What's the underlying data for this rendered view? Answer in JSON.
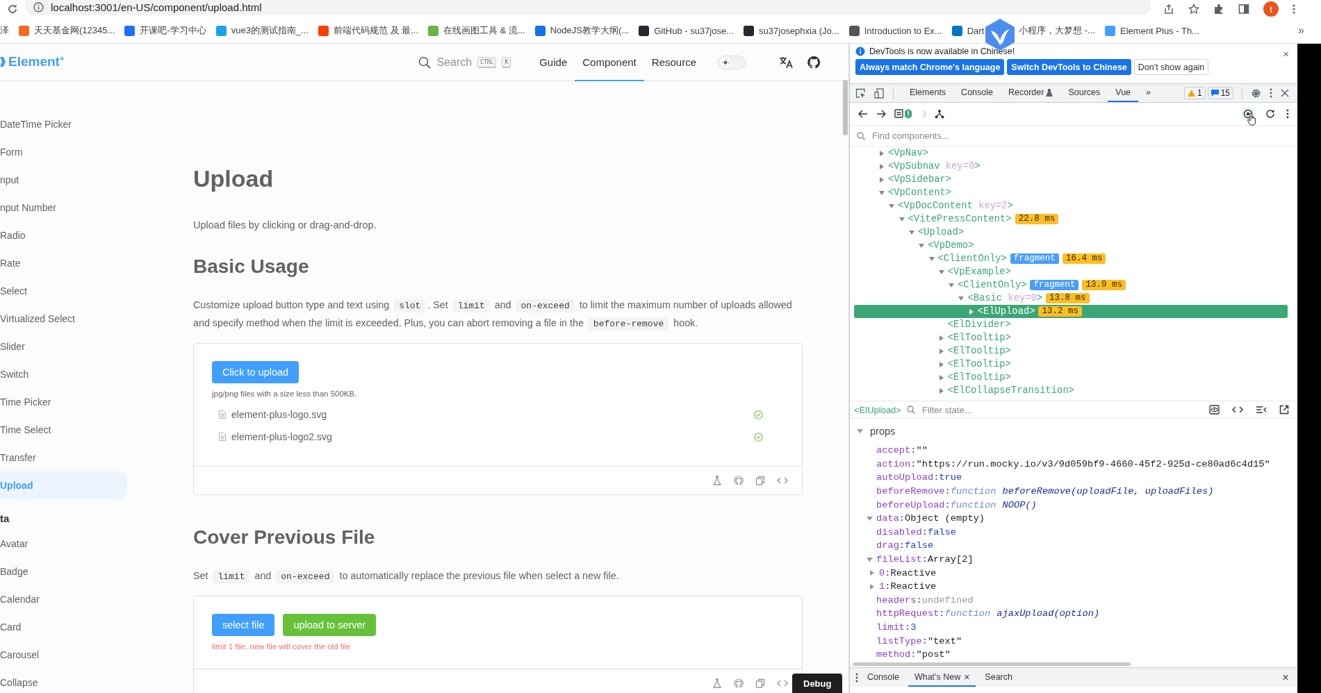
{
  "browser": {
    "url": "localhost:3001/en-US/component/upload.html",
    "avatar": "t",
    "more": "»",
    "bookmarks": [
      {
        "label": "泽"
      },
      {
        "label": "天天基金网(12345...",
        "color": "#f36c21"
      },
      {
        "label": "开课吧-学习中心",
        "color": "#1e6fff"
      },
      {
        "label": "vue3的测试指南_...",
        "color": "#1aa3e8"
      },
      {
        "label": "前端代码规范 及 最...",
        "color": "#ff3d00"
      },
      {
        "label": "在线画图工具 & 流...",
        "color": "#6bb543"
      },
      {
        "label": "NodeJS教学大纲(...",
        "color": "#1473e6"
      },
      {
        "label": "GitHub - su37jose...",
        "color": "#24292f"
      },
      {
        "label": "su37josephxia (Jo...",
        "color": "#24292f"
      },
      {
        "label": "Introduction to Ex...",
        "color": "#555555"
      },
      {
        "label": "Dart",
        "color": "#0175c2"
      },
      {
        "label": "小程序，大梦想 -..."
      },
      {
        "label": "Element Plus - Th...",
        "color": "#409eff"
      }
    ]
  },
  "header": {
    "logo": "Element$^{+}$",
    "search": "Search",
    "keys": [
      "CTRL",
      "K"
    ],
    "dark_mode": false,
    "nav": [
      {
        "label": "Guide",
        "selected": false
      },
      {
        "label": "Component",
        "selected": true
      },
      {
        "label": "Resource",
        "selected": false
      }
    ]
  },
  "sidebar": [
    {
      "kind": "item",
      "label": "DateTime Picker",
      "selected": false
    },
    {
      "kind": "item",
      "label": "Form",
      "selected": false
    },
    {
      "kind": "item",
      "label": "nput",
      "selected": false
    },
    {
      "kind": "item",
      "label": "nput Number",
      "selected": false
    },
    {
      "kind": "item",
      "label": "Radio",
      "selected": false
    },
    {
      "kind": "item",
      "label": "Rate",
      "selected": false
    },
    {
      "kind": "item",
      "label": "Select",
      "selected": false
    },
    {
      "kind": "item",
      "label": "Virtualized Select",
      "selected": false
    },
    {
      "kind": "item",
      "label": "Slider",
      "selected": false
    },
    {
      "kind": "item",
      "label": "Switch",
      "selected": false
    },
    {
      "kind": "item",
      "label": "Time Picker",
      "selected": false
    },
    {
      "kind": "item",
      "label": "Time Select",
      "selected": false
    },
    {
      "kind": "item",
      "label": "Transfer",
      "selected": false
    },
    {
      "kind": "item",
      "label": "Upload",
      "selected": true
    },
    {
      "kind": "heading",
      "label": "ta"
    },
    {
      "kind": "item",
      "label": "Avatar",
      "selected": false
    },
    {
      "kind": "item",
      "label": "Badge",
      "selected": false
    },
    {
      "kind": "item",
      "label": "Calendar",
      "selected": false
    },
    {
      "kind": "item",
      "label": "Card",
      "selected": false
    },
    {
      "kind": "item",
      "label": "Carousel",
      "selected": false
    },
    {
      "kind": "item",
      "label": "Collapse",
      "selected": false
    }
  ],
  "content": {
    "title": "Upload",
    "intro": "Upload files by clicking or drag-and-drop.",
    "sections": [
      {
        "heading": "Basic Usage",
        "paragraph": [
          {
            "kind": "text",
            "text": "Customize upload button type and text using "
          },
          {
            "kind": "code",
            "text": "slot"
          },
          {
            "kind": "text",
            "text": ". Set "
          },
          {
            "kind": "code",
            "text": "limit"
          },
          {
            "kind": "text",
            "text": " and "
          },
          {
            "kind": "code",
            "text": "on-exceed"
          },
          {
            "kind": "text",
            "text": " to limit the maximum number of uploads allowed and specify method when the limit is exceeded. Plus, you can abort removing a file in the "
          },
          {
            "kind": "code",
            "text": "before-remove"
          },
          {
            "kind": "text",
            "text": " hook."
          }
        ],
        "demo": {
          "buttons": [
            {
              "label": "Click to upload",
              "kind": "primary"
            }
          ],
          "tip": {
            "text": "jpg/png files with a size less than 500KB.",
            "kind": "info"
          },
          "files": [
            {
              "name": "element-plus-logo.svg",
              "uploaded": true
            },
            {
              "name": "element-plus-logo2.svg",
              "uploaded": true
            }
          ]
        }
      },
      {
        "heading": "Cover Previous File",
        "paragraph": [
          {
            "kind": "text",
            "text": "Set "
          },
          {
            "kind": "code",
            "text": "limit"
          },
          {
            "kind": "text",
            "text": " and "
          },
          {
            "kind": "code",
            "text": "on-exceed"
          },
          {
            "kind": "text",
            "text": " to automatically replace the previous file when select a new file."
          }
        ],
        "demo": {
          "buttons": [
            {
              "label": "select file",
              "kind": "primary"
            },
            {
              "label": "upload to server",
              "kind": "success"
            }
          ],
          "tip": {
            "text": "limit 1 file, new file will cover the old file",
            "kind": "danger"
          }
        }
      }
    ]
  },
  "debug_button": "Debug",
  "devtools": {
    "notice": "DevTools is now available in Chinese!",
    "notice_buttons": [
      {
        "label": "Always match Chrome's language",
        "kind": "primary"
      },
      {
        "label": "Switch DevTools to Chinese",
        "kind": "primary"
      },
      {
        "label": "Don't show again",
        "kind": "plain"
      }
    ],
    "tabs": [
      {
        "label": "Elements",
        "selected": false
      },
      {
        "label": "Console",
        "selected": false
      },
      {
        "label": "Recorder",
        "selected": false
      },
      {
        "label": "Sources",
        "selected": false
      },
      {
        "label": "Vue",
        "selected": true
      }
    ],
    "tabs_more": "»",
    "warnings": "1",
    "messages": "15",
    "find_placeholder": "Find components...",
    "tag_open": "<",
    "tag_close": ">",
    "separator": ": ",
    "tree": [
      {
        "name": "VpNav",
        "expanded": false,
        "selected": false
      },
      {
        "name": "VpSubnav",
        "key": "key=0",
        "expanded": false,
        "selected": false
      },
      {
        "name": "VpSidebar",
        "expanded": false,
        "selected": false
      },
      {
        "name": "VpContent",
        "expanded": true,
        "selected": false,
        "children": [
          {
            "name": "VpDocContent",
            "key": "key=2",
            "expanded": true,
            "selected": false,
            "children": [
              {
                "name": "VitePressContent",
                "expanded": true,
                "selected": false,
                "badges": [
                  {
                    "kind": "time",
                    "text": "22.8 ms"
                  }
                ],
                "children": [
                  {
                    "name": "Upload",
                    "expanded": true,
                    "selected": false,
                    "children": [
                      {
                        "name": "VpDemo",
                        "expanded": true,
                        "selected": false,
                        "children": [
                          {
                            "name": "ClientOnly",
                            "expanded": true,
                            "selected": false,
                            "badges": [
                              {
                                "kind": "fragment",
                                "text": "fragment"
                              },
                              {
                                "kind": "time",
                                "text": "16.4 ms"
                              }
                            ],
                            "children": [
                              {
                                "name": "VpExample",
                                "expanded": true,
                                "selected": false,
                                "children": [
                                  {
                                    "name": "ClientOnly",
                                    "expanded": true,
                                    "selected": false,
                                    "badges": [
                                      {
                                        "kind": "fragment",
                                        "text": "fragment"
                                      },
                                      {
                                        "kind": "time",
                                        "text": "13.9 ms"
                                      }
                                    ],
                                    "children": [
                                      {
                                        "name": "Basic",
                                        "key": "key=0",
                                        "expanded": true,
                                        "selected": false,
                                        "badges": [
                                          {
                                            "kind": "time",
                                            "text": "13.8 ms"
                                          }
                                        ],
                                        "children": [
                                          {
                                            "name": "ElUpload",
                                            "expanded": false,
                                            "selected": true,
                                            "badges": [
                                              {
                                                "kind": "time",
                                                "text": "13.2 ms"
                                              }
                                            ]
                                          }
                                        ]
                                      }
                                    ]
                                  }
                                ]
                              },
                              {
                                "name": "ElDivider",
                                "selected": false
                              },
                              {
                                "name": "ElTooltip",
                                "expanded": false,
                                "selected": false
                              },
                              {
                                "name": "ElTooltip",
                                "expanded": false,
                                "selected": false
                              },
                              {
                                "name": "ElTooltip",
                                "expanded": false,
                                "selected": false
                              },
                              {
                                "name": "ElTooltip",
                                "expanded": false,
                                "selected": false
                              },
                              {
                                "name": "ElCollapseTransition",
                                "expanded": false,
                                "selected": false
                              }
                            ]
                          }
                        ]
                      }
                    ]
                  }
                ]
              }
            ]
          }
        ]
      }
    ],
    "state_component": "<ElUpload>",
    "filter_placeholder": "Filter state...",
    "state_section": {
      "label": "props",
      "expanded": true
    },
    "props": [
      {
        "key": "accept",
        "kind": "string",
        "value": "\"\""
      },
      {
        "key": "action",
        "kind": "string",
        "value": "\"https://run.mocky.io/v3/9d059bf9-4660-45f2-925d-ce80ad6c4d15\""
      },
      {
        "key": "autoUpload",
        "kind": "literal",
        "value": "true"
      },
      {
        "key": "beforeRemove",
        "kind": "function",
        "prefix": "function",
        "value": "beforeRemove(uploadFile, uploadFiles)"
      },
      {
        "key": "beforeUpload",
        "kind": "function",
        "prefix": "function",
        "value": "NOOP()"
      },
      {
        "key": "data",
        "kind": "object",
        "value": "Object (empty)",
        "expanded": true
      },
      {
        "key": "disabled",
        "kind": "literal",
        "value": "false"
      },
      {
        "key": "drag",
        "kind": "literal",
        "value": "false"
      },
      {
        "key": "fileList",
        "kind": "object",
        "value": "Array[2]",
        "expanded": true,
        "children": [
          {
            "key": "0",
            "kind": "object",
            "value": "Reactive",
            "expanded": false
          },
          {
            "key": "1",
            "kind": "object",
            "value": "Reactive",
            "expanded": false
          }
        ]
      },
      {
        "key": "headers",
        "kind": "undefined",
        "value": "undefined"
      },
      {
        "key": "httpRequest",
        "kind": "function",
        "prefix": "function",
        "value": "ajaxUpload(option)"
      },
      {
        "key": "limit",
        "kind": "literal",
        "value": "3"
      },
      {
        "key": "listType",
        "kind": "string",
        "value": "\"text\""
      },
      {
        "key": "method",
        "kind": "string",
        "value": "\"post\""
      }
    ],
    "drawer_tabs": [
      {
        "label": "Console",
        "selected": false,
        "closable": false
      },
      {
        "label": "What's New",
        "selected": true,
        "closable": true
      },
      {
        "label": "Search",
        "selected": false,
        "closable": false
      }
    ],
    "close_glyph": "×"
  }
}
